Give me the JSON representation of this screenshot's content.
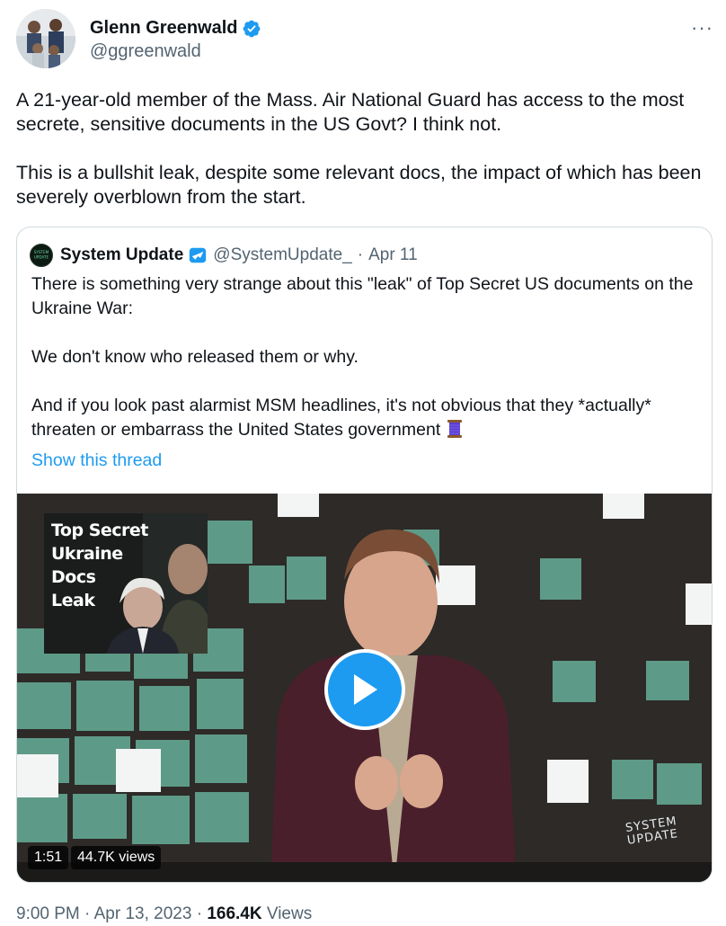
{
  "author": {
    "name": "Glenn Greenwald",
    "handle": "@ggreenwald",
    "more_icon": "more-horizontal-icon",
    "verified_color": "#1d9bf0"
  },
  "tweet": {
    "paragraphs": [
      "A 21-year-old member of the Mass. Air National Guard has access to the most secrete, sensitive documents in the US Govt? I think not.",
      "This is a bullshit leak, despite some relevant docs, the impact of which has been severely overblown from the start."
    ]
  },
  "quoted": {
    "name": "System Update",
    "handle": "@SystemUpdate_",
    "separator": "·",
    "date": "Apr 11",
    "paragraphs": [
      "There is something very strange about this \"leak\" of Top Secret US documents on the Ukraine War:",
      "We don't know who released them or why.",
      "And if you look past alarmist MSM headlines, it's not obvious that they *actually* threaten or embarrass the United States government"
    ],
    "emoji_icon": "thread-spool-icon",
    "show_thread": "Show this thread",
    "avatar_text": "SYSTEM UPDATE"
  },
  "video": {
    "thumbnail_title": "Top Secret\nUkraine\nDocs\nLeak",
    "brand": "SYSTEM\nUPDATE",
    "duration": "1:51",
    "views": "44.7K views",
    "play_icon": "play-icon",
    "accent": "#1d9bf0",
    "tile_color": "#5e9a88"
  },
  "footer": {
    "time": "9:00 PM",
    "date": "Apr 13, 2023",
    "views_count": "166.4K",
    "views_label": "Views",
    "separator": "·"
  }
}
